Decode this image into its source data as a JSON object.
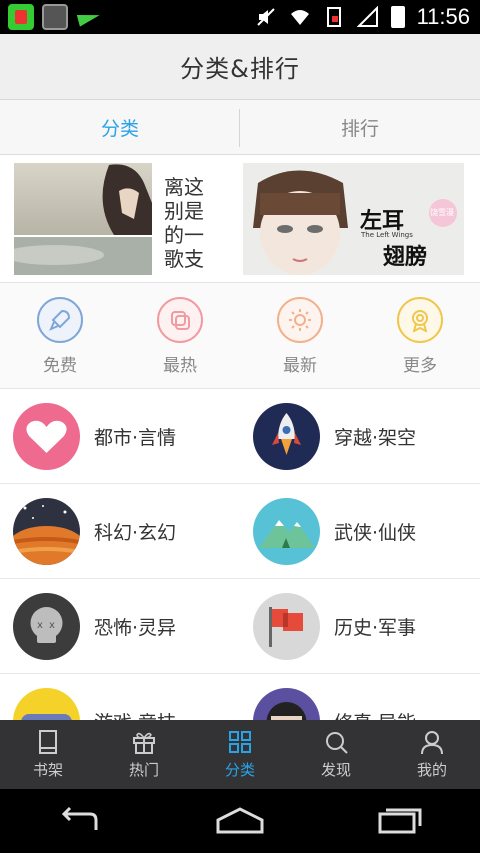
{
  "status_bar": {
    "time": "11:56"
  },
  "header": {
    "title": "分类&排行"
  },
  "tabs": [
    {
      "label": "分类",
      "active": true
    },
    {
      "label": "排行",
      "active": false
    }
  ],
  "banners": [
    {
      "title_chars": [
        "离这",
        "别是",
        "的一",
        "歌支"
      ]
    },
    {
      "title": "左耳",
      "title2": "翅膀",
      "subtitle": "The Left Wings",
      "badge": "饶雪漫"
    }
  ],
  "quick": [
    {
      "label": "免费",
      "icon": "rocket-icon",
      "color": "#7fa6d9"
    },
    {
      "label": "最热",
      "icon": "layers-icon",
      "color": "#f19aa0"
    },
    {
      "label": "最新",
      "icon": "sun-icon",
      "color": "#f3b08d"
    },
    {
      "label": "更多",
      "icon": "badge-icon",
      "color": "#f1c64d"
    }
  ],
  "categories": [
    {
      "label": "都市·言情",
      "icon": "heart-icon"
    },
    {
      "label": "穿越·架空",
      "icon": "rocket-icon"
    },
    {
      "label": "科幻·玄幻",
      "icon": "planet-icon"
    },
    {
      "label": "武侠·仙侠",
      "icon": "mountain-icon"
    },
    {
      "label": "恐怖·灵异",
      "icon": "skull-icon"
    },
    {
      "label": "历史·军事",
      "icon": "flag-icon"
    },
    {
      "label": "游戏·竞技",
      "icon": "gamepad-icon"
    },
    {
      "label": "修真·异能",
      "icon": "ninja-icon"
    }
  ],
  "bottom_nav": [
    {
      "label": "书架",
      "icon": "book-icon",
      "active": false
    },
    {
      "label": "热门",
      "icon": "gift-icon",
      "active": false
    },
    {
      "label": "分类",
      "icon": "grid-icon",
      "active": true
    },
    {
      "label": "发现",
      "icon": "search-icon",
      "active": false
    },
    {
      "label": "我的",
      "icon": "user-icon",
      "active": false
    }
  ],
  "colors": {
    "accent": "#2aa3e6",
    "nav_bg": "#333335"
  }
}
